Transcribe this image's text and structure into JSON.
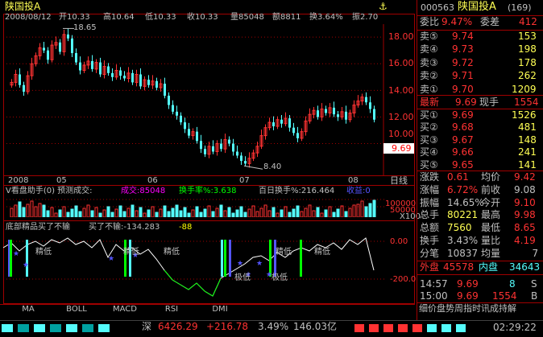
{
  "header": {
    "stock_name": "陕国投A",
    "date": "2008/08/12",
    "open": "开10.33",
    "high": "高10.64",
    "low": "低10.33",
    "close": "收10.33",
    "volume": "量85048",
    "amount": "额8811",
    "turnover": "换3.64%",
    "amplitude": "振2.70"
  },
  "price_axis": {
    "ticks": [
      "18.00",
      "16.00",
      "14.00",
      "12.00",
      "10.00"
    ],
    "current": "9.69"
  },
  "annotations": {
    "high": "18.65",
    "low": "8.40"
  },
  "time_axis": {
    "labels": [
      "2008",
      "05",
      "06",
      "07",
      "08"
    ],
    "right_label": "日线"
  },
  "volume_panel": {
    "title": "V看盘助手(0) 预测成交:",
    "chengjiao": "成交:85048",
    "huanshou": "换手率%:3.638",
    "bairi": "百日换手%:216.464",
    "shouyi": "收益:0",
    "axis": [
      "100000",
      "50000",
      "X100"
    ]
  },
  "indicator_panel": {
    "title": "底部精品买了不输",
    "value": "买了不输:-134.283",
    "value2": "-88",
    "axis": [
      "0.00",
      "-200.0"
    ],
    "labels": [
      "精低",
      "精低",
      "精低",
      "极低",
      "极低",
      "精低",
      "精低"
    ]
  },
  "bottom_tabs": [
    "MA",
    "BOLL",
    "MACD",
    "RSI",
    "DMI"
  ],
  "quote": {
    "code": "000563",
    "name": "陕国投A",
    "count": "(169)",
    "weibi_label": "委比",
    "weibi_val": "9.47%",
    "weicha_label": "委差",
    "weicha_val": "412",
    "sells": [
      {
        "label": "卖⑤",
        "price": "9.74",
        "vol": "153"
      },
      {
        "label": "卖④",
        "price": "9.73",
        "vol": "198"
      },
      {
        "label": "卖③",
        "price": "9.72",
        "vol": "178"
      },
      {
        "label": "卖②",
        "price": "9.71",
        "vol": "262"
      },
      {
        "label": "卖①",
        "price": "9.70",
        "vol": "1209"
      }
    ],
    "latest_label": "最新",
    "latest_val": "9.69",
    "xianshou_label": "现手",
    "xianshou_val": "1554",
    "buys": [
      {
        "label": "买①",
        "price": "9.69",
        "vol": "1526"
      },
      {
        "label": "买②",
        "price": "9.68",
        "vol": "481"
      },
      {
        "label": "买③",
        "price": "9.67",
        "vol": "148"
      },
      {
        "label": "买④",
        "price": "9.66",
        "vol": "241"
      },
      {
        "label": "买⑤",
        "price": "9.65",
        "vol": "141"
      }
    ],
    "stats": [
      {
        "l1": "涨跌",
        "v1": "0.61",
        "l2": "均价",
        "v2": "9.42"
      },
      {
        "l1": "涨幅",
        "v1": "6.72%",
        "l2": "前收",
        "v2": "9.08"
      },
      {
        "l1": "振幅",
        "v1": "14.65%",
        "l2": "今开",
        "v2": "9.10"
      },
      {
        "l1": "总手",
        "v1": "80221",
        "l2": "最高",
        "v2": "9.98"
      },
      {
        "l1": "总额",
        "v1": "7560",
        "l2": "最低",
        "v2": "8.65"
      },
      {
        "l1": "换手",
        "v1": "3.43%",
        "l2": "量比",
        "v2": "4.19"
      },
      {
        "l1": "分笔",
        "v1": "10837",
        "l2": "均量",
        "v2": "7"
      }
    ],
    "waipan_label": "外盘",
    "waipan_val": "45578",
    "neipan_label": "内盘",
    "neipan_val": "34643",
    "ticks": [
      {
        "time": "14:57",
        "price": "9.69",
        "vol": "8",
        "flag": "S"
      },
      {
        "time": "15:00",
        "price": "9.69",
        "vol": "1554",
        "flag": "B"
      }
    ],
    "footer": "细价盘势周指时讯成持解"
  },
  "status": {
    "index_name": "深",
    "index_val": "6426.29",
    "change": "+216.78",
    "pct": "3.49%",
    "amount": "146.03亿",
    "clock": "02:29:22"
  },
  "colors": {
    "up": "#ff3232",
    "down": "#54fcfc",
    "yellow": "#ffff00",
    "grid": "#a00000",
    "magenta": "#ff00ff",
    "green": "#00ff00"
  }
}
